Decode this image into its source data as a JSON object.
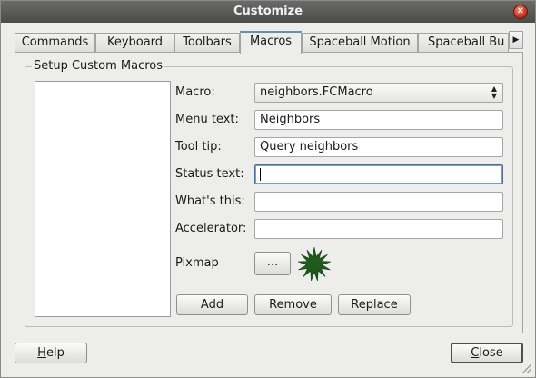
{
  "window": {
    "title": "Customize"
  },
  "tabs": [
    "Commands",
    "Keyboard",
    "Toolbars",
    "Macros",
    "Spaceball Motion",
    "Spaceball Bu"
  ],
  "active_tab": "Macros",
  "group": {
    "title": "Setup Custom Macros",
    "macro_label": "Macro:",
    "macro_value": "neighbors.FCMacro",
    "menu_text_label": "Menu text:",
    "menu_text_value": "Neighbors",
    "tool_tip_label": "Tool tip:",
    "tool_tip_value": "Query neighbors",
    "status_text_label": "Status text:",
    "status_text_value": "",
    "whats_this_label": "What's this:",
    "whats_this_value": "",
    "accelerator_label": "Accelerator:",
    "accelerator_value": "",
    "pixmap_label": "Pixmap",
    "pixmap_button": "...",
    "pixmap_icon": "green-starburst-icon",
    "add_button": "Add",
    "remove_button": "Remove",
    "replace_button": "Replace"
  },
  "footer": {
    "help_prefix": "",
    "help_mnemonic": "H",
    "help_rest": "elp",
    "close_mnemonic": "C",
    "close_rest": "lose"
  },
  "colors": {
    "titlebar": "#4b4b4a",
    "pixmap_green": "#1f5b1a",
    "close_red": "#c9321d"
  }
}
